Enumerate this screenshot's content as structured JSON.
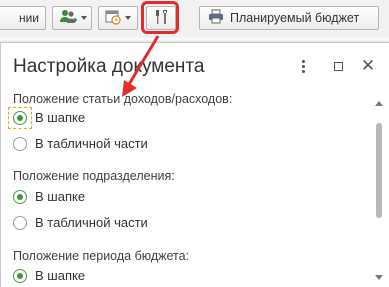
{
  "toolbar": {
    "partial_button_label": "нии",
    "budget_button_label": "Планируемый бюджет",
    "icons": {
      "users": "users-icon",
      "calendar": "calendar-icon",
      "settings": "wrench-screwdriver-icon",
      "budget": "printer-icon"
    },
    "highlight_color": "#e22d2a"
  },
  "dialog": {
    "title": "Настройка документа",
    "groups": [
      {
        "label": "Положение статьи доходов/расходов:",
        "options": [
          {
            "label": "В шапке",
            "checked": true
          },
          {
            "label": "В табличной части",
            "checked": false
          }
        ]
      },
      {
        "label": "Положение подразделения:",
        "options": [
          {
            "label": "В шапке",
            "checked": true
          },
          {
            "label": "В табличной части",
            "checked": false
          }
        ]
      },
      {
        "label": "Положение периода бюджета:",
        "options": [
          {
            "label": "В шапке",
            "checked": true
          }
        ]
      }
    ],
    "accent_color": "#3a9a3a"
  }
}
